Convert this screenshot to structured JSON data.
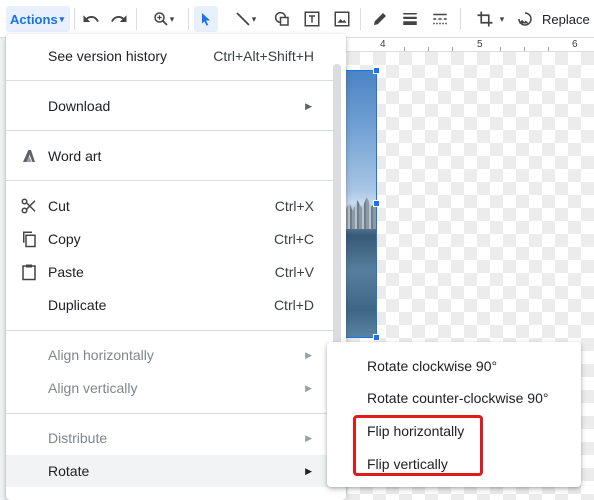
{
  "toolbar": {
    "actions_label": "Actions",
    "replace_label": "Replace"
  },
  "ruler": {
    "labels": [
      "4",
      "5",
      "6"
    ]
  },
  "menu": {
    "items": [
      {
        "label": "See version history",
        "shortcut": "Ctrl+Alt+Shift+H"
      },
      {
        "label": "Download",
        "submenu": true
      },
      {
        "label": "Word art",
        "icon": "word-art-icon"
      },
      {
        "label": "Cut",
        "shortcut": "Ctrl+X",
        "icon": "scissors-icon"
      },
      {
        "label": "Copy",
        "shortcut": "Ctrl+C",
        "icon": "copy-icon"
      },
      {
        "label": "Paste",
        "shortcut": "Ctrl+V",
        "icon": "clipboard-icon"
      },
      {
        "label": "Duplicate",
        "shortcut": "Ctrl+D"
      },
      {
        "label": "Align horizontally",
        "submenu": true,
        "disabled": true
      },
      {
        "label": "Align vertically",
        "submenu": true,
        "disabled": true
      },
      {
        "label": "Distribute",
        "submenu": true,
        "disabled": true
      },
      {
        "label": "Rotate",
        "submenu": true,
        "highlighted": true
      }
    ]
  },
  "submenu": {
    "items": [
      {
        "label": "Rotate clockwise 90°"
      },
      {
        "label": "Rotate counter-clockwise 90°"
      },
      {
        "label": "Flip horizontally"
      },
      {
        "label": "Flip vertically"
      }
    ]
  },
  "colors": {
    "accent": "#1a73e8",
    "highlight_box": "#e01b1b",
    "menu_hover": "#f1f3f4"
  }
}
